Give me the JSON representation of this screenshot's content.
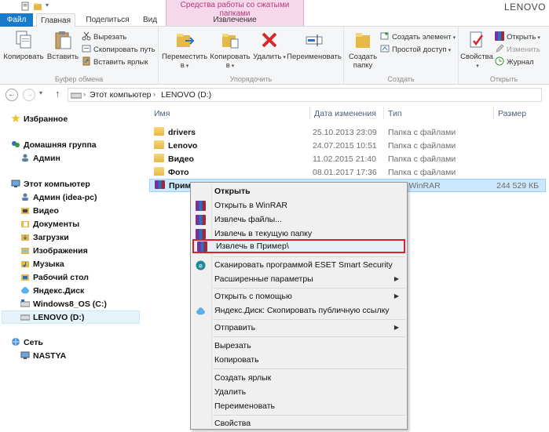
{
  "window": {
    "context_group_title": "Средства работы со сжатыми папками",
    "title_partial": "LENOVO"
  },
  "tabs": {
    "file": "Файл",
    "home": "Главная",
    "share": "Поделиться",
    "view": "Вид",
    "extract": "Извлечение"
  },
  "ribbon": {
    "clipboard": {
      "label": "Буфер обмена",
      "copy": "Копировать",
      "paste": "Вставить",
      "cut": "Вырезать",
      "copy_path": "Скопировать путь",
      "paste_shortcut": "Вставить ярлык"
    },
    "organize": {
      "label": "Упорядочить",
      "move_to_l1": "Переместить",
      "move_to_l2": "в",
      "copy_to_l1": "Копировать",
      "copy_to_l2": "в",
      "delete": "Удалить",
      "rename": "Переименовать"
    },
    "create": {
      "label": "Создать",
      "new_folder_l1": "Создать",
      "new_folder_l2": "папку",
      "new_item": "Создать элемент",
      "easy_access": "Простой доступ"
    },
    "open": {
      "label": "Открыть",
      "properties": "Свойства",
      "open": "Открыть",
      "edit": "Изменить",
      "history": "Журнал"
    }
  },
  "address": {
    "computer": "Этот компьютер",
    "drive": "LENOVO (D:)"
  },
  "nav": {
    "favorites": "Избранное",
    "homegroup": "Домашняя группа",
    "homegroup_user": "Админ",
    "this_pc": "Этот компьютер",
    "pc_items": [
      "Админ (idea-pc)",
      "Видео",
      "Документы",
      "Загрузки",
      "Изображения",
      "Музыка",
      "Рабочий стол",
      "Яндекс.Диск",
      "Windows8_OS (C:)",
      "LENOVO (D:)"
    ],
    "network": "Сеть",
    "network_item": "NASTYA"
  },
  "columns": {
    "name": "Имя",
    "date": "Дата изменения",
    "type": "Тип",
    "size": "Размер"
  },
  "files": [
    {
      "name": "drivers",
      "date": "25.10.2013 23:09",
      "type": "Папка с файлами",
      "size": ""
    },
    {
      "name": "Lenovo",
      "date": "24.07.2015 10:51",
      "type": "Папка с файлами",
      "size": ""
    },
    {
      "name": "Видео",
      "date": "11.02.2015 21:40",
      "type": "Папка с файлами",
      "size": ""
    },
    {
      "name": "Фото",
      "date": "08.01.2017 17:36",
      "type": "Папка с файлами",
      "size": ""
    },
    {
      "name": "Пример",
      "date": "",
      "type": "ZIP - WinRAR",
      "size": "244 529 КБ"
    }
  ],
  "context_menu": {
    "open": "Открыть",
    "open_winrar": "Открыть в WinRAR",
    "extract_files": "Извлечь файлы...",
    "extract_here": "Извлечь в текущую папку",
    "extract_to": "Извлечь в Пример\\",
    "eset_scan": "Сканировать программой ESET Smart Security",
    "advanced": "Расширенные параметры",
    "open_with": "Открыть с помощью",
    "yadisk_copy": "Яндекс.Диск: Скопировать публичную ссылку",
    "send_to": "Отправить",
    "cut": "Вырезать",
    "copy": "Копировать",
    "create_shortcut": "Создать ярлык",
    "delete": "Удалить",
    "rename": "Переименовать",
    "properties": "Свойства"
  },
  "colors": {
    "file_tab": "#1979ca",
    "context_tab": "#f7d7ea",
    "selection": "#cce8ff",
    "highlight_border": "#d9202c"
  }
}
